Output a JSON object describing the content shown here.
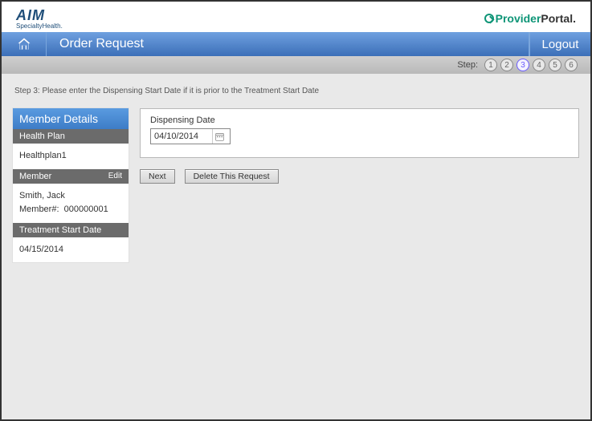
{
  "branding": {
    "aim": "AIM",
    "aimSub": "SpecialtyHealth.",
    "provider": "Provider",
    "portal": "Portal"
  },
  "nav": {
    "title": "Order Request",
    "logout": "Logout"
  },
  "steps": {
    "label": "Step:",
    "items": [
      "1",
      "2",
      "3",
      "4",
      "5",
      "6"
    ],
    "active": 3
  },
  "instruction": "Step 3: Please enter the Dispensing Start Date if it is prior to the Treatment Start Date",
  "sidebar": {
    "title": "Member Details",
    "healthPlan": {
      "label": "Health Plan",
      "value": "Healthplan1"
    },
    "member": {
      "label": "Member",
      "edit": "Edit",
      "name": "Smith, Jack",
      "numberLabel": "Member#:",
      "number": "000000001"
    },
    "treatmentStart": {
      "label": "Treatment Start Date",
      "value": "04/15/2014"
    }
  },
  "form": {
    "dispensingDate": {
      "label": "Dispensing Date",
      "value": "04/10/2014"
    }
  },
  "buttons": {
    "next": "Next",
    "delete": "Delete This Request"
  }
}
